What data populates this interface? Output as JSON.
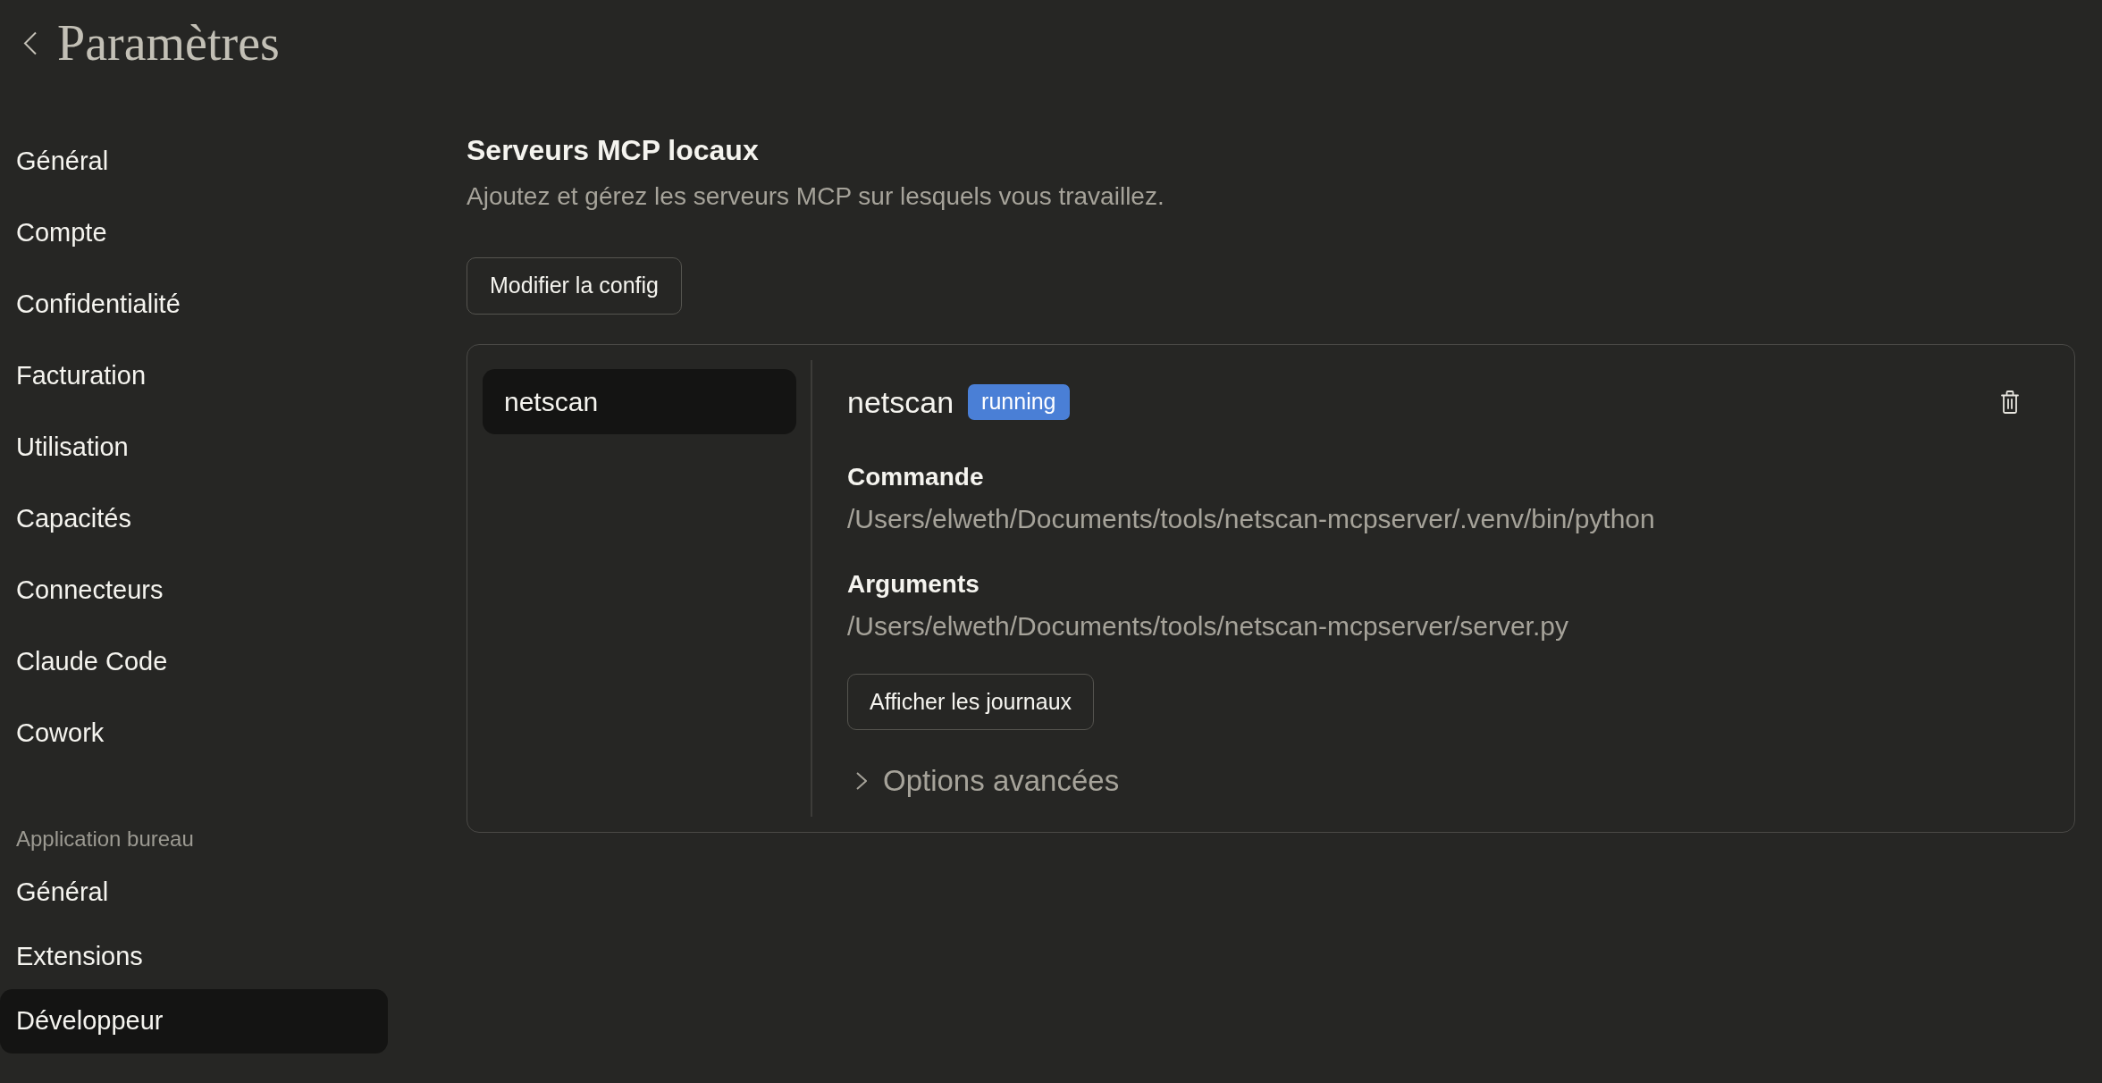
{
  "header": {
    "title": "Paramètres"
  },
  "sidebar": {
    "groups": [
      {
        "items": [
          {
            "label": "Général",
            "selected": false
          },
          {
            "label": "Compte",
            "selected": false
          },
          {
            "label": "Confidentialité",
            "selected": false
          },
          {
            "label": "Facturation",
            "selected": false
          },
          {
            "label": "Utilisation",
            "selected": false
          },
          {
            "label": "Capacités",
            "selected": false
          },
          {
            "label": "Connecteurs",
            "selected": false
          },
          {
            "label": "Claude Code",
            "selected": false
          },
          {
            "label": "Cowork",
            "selected": false
          }
        ]
      },
      {
        "heading": "Application bureau",
        "items": [
          {
            "label": "Général",
            "selected": false
          },
          {
            "label": "Extensions",
            "selected": false
          },
          {
            "label": "Développeur",
            "selected": true
          }
        ]
      }
    ]
  },
  "section": {
    "title": "Serveurs MCP locaux",
    "description": "Ajoutez et gérez les serveurs MCP sur lesquels vous travaillez.",
    "edit_button": "Modifier la config"
  },
  "servers": [
    {
      "name": "netscan",
      "selected": true
    }
  ],
  "detail": {
    "name": "netscan",
    "status": "running",
    "fields": [
      {
        "label": "Commande",
        "value": "/Users/elweth/Documents/tools/netscan-mcpserver/.venv/bin/python"
      },
      {
        "label": "Arguments",
        "value": "/Users/elweth/Documents/tools/netscan-mcpserver/server.py"
      }
    ],
    "logs_button": "Afficher les journaux",
    "advanced": {
      "label": "Options avancées",
      "expanded": false
    }
  }
}
